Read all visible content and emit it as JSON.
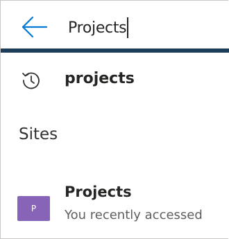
{
  "search": {
    "value": "Projects"
  },
  "icons": {
    "back": "back-arrow-icon",
    "history": "history-icon"
  },
  "colors": {
    "accent_bar": "#1e3d58",
    "back_arrow": "#0078d4",
    "site_tile": "#8764b8"
  },
  "history": {
    "items": [
      {
        "label": "projects"
      }
    ]
  },
  "sections": {
    "sites_heading": "Sites"
  },
  "sites": {
    "items": [
      {
        "initial": "P",
        "title": "Projects",
        "subtitle": "You recently accessed"
      }
    ]
  }
}
